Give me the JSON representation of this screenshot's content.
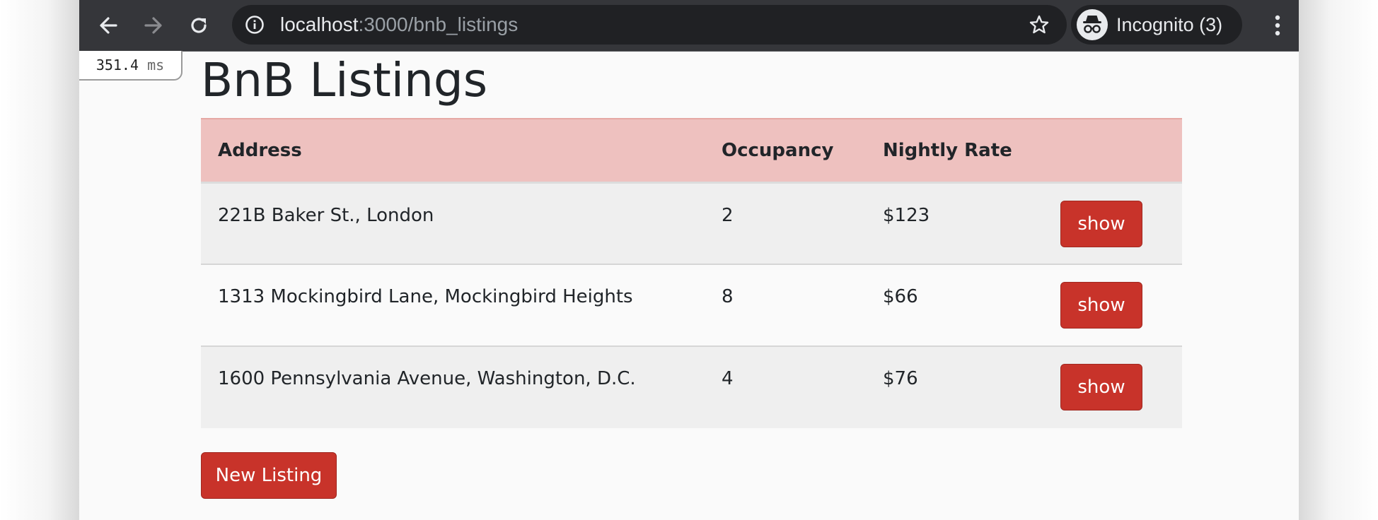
{
  "browser": {
    "back_icon": "arrow-left-icon",
    "forward_icon": "arrow-right-icon",
    "reload_icon": "reload-icon",
    "url_host": "localhost",
    "url_rest": ":3000/bnb_listings",
    "profile_label": "Incognito (3)",
    "toolbar_color": "#35363a"
  },
  "timing": {
    "value": "351.4",
    "unit": "ms"
  },
  "page": {
    "title": "BnB Listings"
  },
  "table": {
    "headers": {
      "address": "Address",
      "occupancy": "Occupancy",
      "rate": "Nightly Rate"
    },
    "rows": [
      {
        "address": "221B Baker St., London",
        "occupancy": "2",
        "rate": "$123",
        "action": "show"
      },
      {
        "address": "1313 Mockingbird Lane, Mockingbird Heights",
        "occupancy": "8",
        "rate": "$66",
        "action": "show"
      },
      {
        "address": "1600 Pennsylvania Avenue, Washington, D.C.",
        "occupancy": "4",
        "rate": "$76",
        "action": "show"
      }
    ]
  },
  "new_listing_label": "New Listing",
  "colors": {
    "accent": "#c8332a",
    "header_bg": "#eec1bf"
  }
}
